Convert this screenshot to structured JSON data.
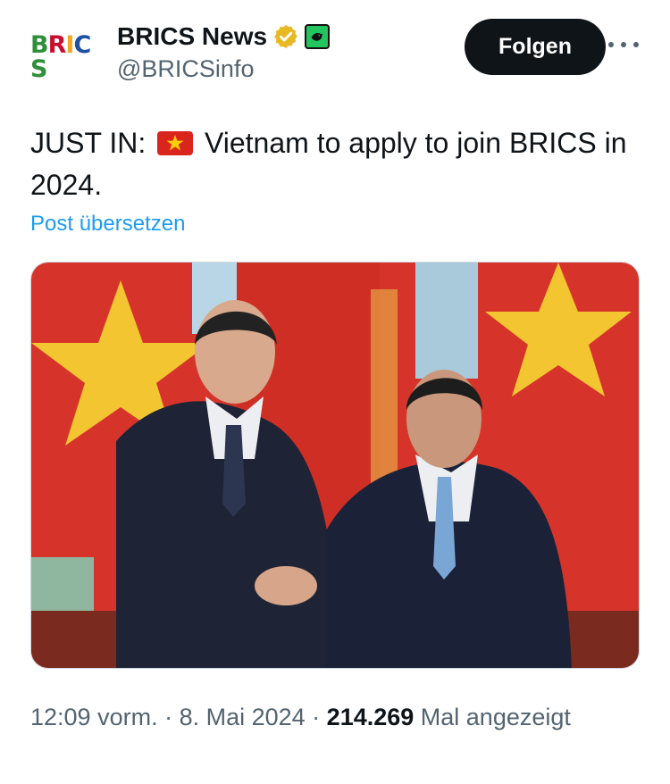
{
  "account": {
    "logo_letters": [
      "B",
      "R",
      "I",
      "C",
      "S"
    ],
    "logo_colors": [
      "#2f8f3a",
      "#c8102e",
      "#f5a623",
      "#1f4fa0",
      "#2f8f3a"
    ],
    "name": "BRICS News",
    "handle": "@BRICSinfo",
    "verified_color": "#e8b923",
    "affiliate_badge_color": "#22c55e"
  },
  "follow_button": {
    "label": "Folgen"
  },
  "more_icon": "more-horizontal-icon",
  "tweet": {
    "text_before_flag": "JUST IN: ",
    "flag_icon": "vietnam-flag-icon",
    "text_after_flag": " Vietnam to apply to join BRICS in 2024.",
    "translate_link": "Post übersetzen"
  },
  "media": {
    "description_icon": "photo"
  },
  "meta": {
    "time": "12:09 vorm.",
    "sep1": " · ",
    "date": "8. Mai 2024",
    "sep2": " · ",
    "views": "214.269",
    "views_suffix": " Mal angezeigt"
  }
}
